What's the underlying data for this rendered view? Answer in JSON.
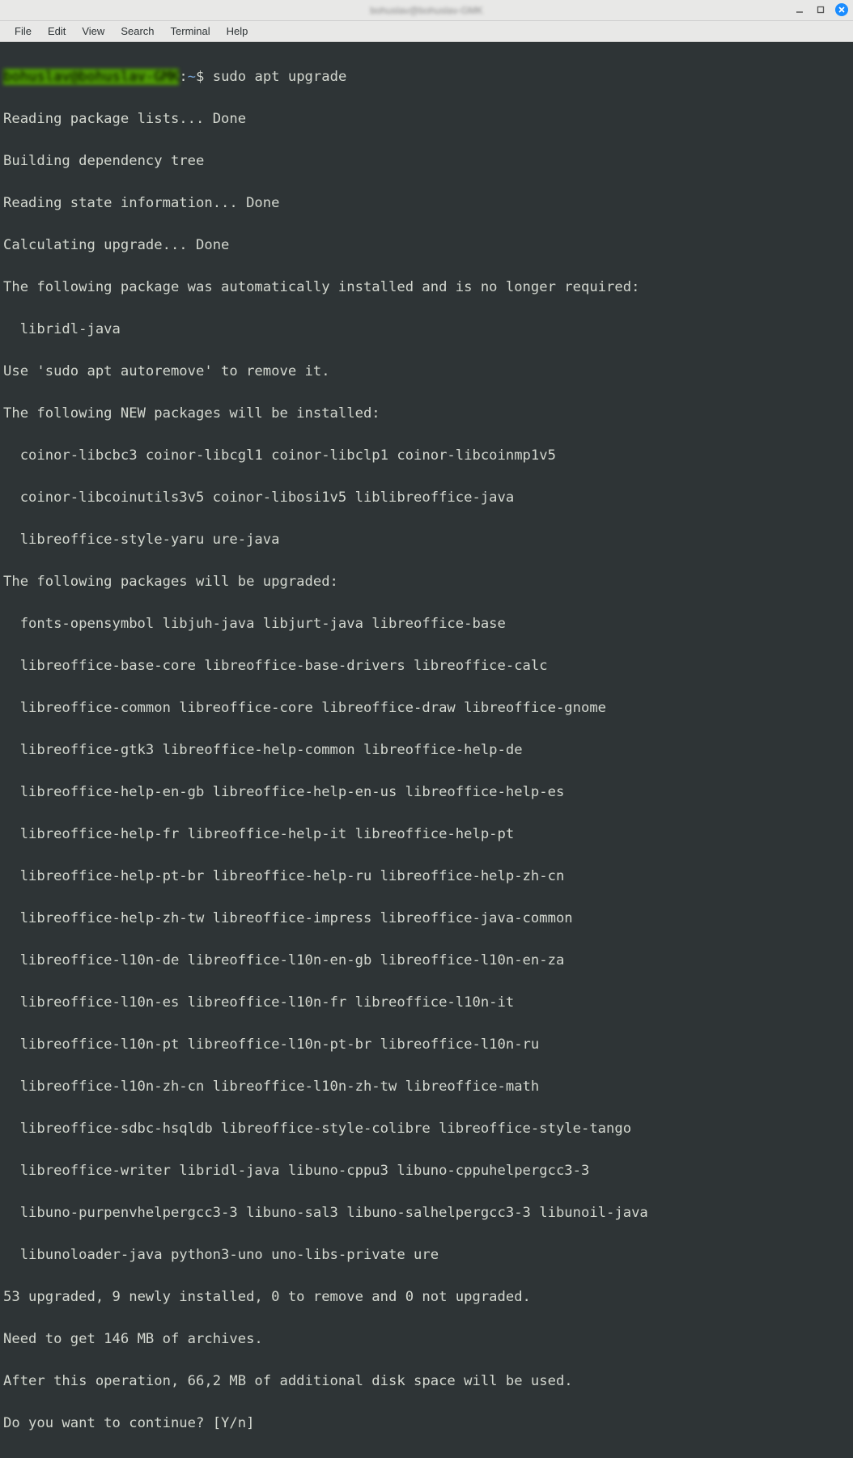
{
  "window": {
    "title": "bohuslav@bohuslav-GMK"
  },
  "menu": {
    "file": "File",
    "edit": "Edit",
    "view": "View",
    "search": "Search",
    "terminal": "Terminal",
    "help": "Help"
  },
  "prompt": {
    "user": "bohuslav@bohuslav-GMK",
    "sep1": ":",
    "path": "~",
    "sep2": "$ ",
    "command": "sudo apt upgrade"
  },
  "out": {
    "l1": "Reading package lists... Done",
    "l2": "Building dependency tree",
    "l3": "Reading state information... Done",
    "l4": "Calculating upgrade... Done",
    "l5": "The following package was automatically installed and is no longer required:",
    "l6": "libridl-java",
    "l7": "Use 'sudo apt autoremove' to remove it.",
    "l8": "The following NEW packages will be installed:",
    "l9": "coinor-libcbc3 coinor-libcgl1 coinor-libclp1 coinor-libcoinmp1v5",
    "l10": "coinor-libcoinutils3v5 coinor-libosi1v5 liblibreoffice-java",
    "l11": "libreoffice-style-yaru ure-java",
    "l12": "The following packages will be upgraded:",
    "l13": "fonts-opensymbol libjuh-java libjurt-java libreoffice-base",
    "l14": "libreoffice-base-core libreoffice-base-drivers libreoffice-calc",
    "l15": "libreoffice-common libreoffice-core libreoffice-draw libreoffice-gnome",
    "l16": "libreoffice-gtk3 libreoffice-help-common libreoffice-help-de",
    "l17": "libreoffice-help-en-gb libreoffice-help-en-us libreoffice-help-es",
    "l18": "libreoffice-help-fr libreoffice-help-it libreoffice-help-pt",
    "l19": "libreoffice-help-pt-br libreoffice-help-ru libreoffice-help-zh-cn",
    "l20": "libreoffice-help-zh-tw libreoffice-impress libreoffice-java-common",
    "l21": "libreoffice-l10n-de libreoffice-l10n-en-gb libreoffice-l10n-en-za",
    "l22": "libreoffice-l10n-es libreoffice-l10n-fr libreoffice-l10n-it",
    "l23": "libreoffice-l10n-pt libreoffice-l10n-pt-br libreoffice-l10n-ru",
    "l24": "libreoffice-l10n-zh-cn libreoffice-l10n-zh-tw libreoffice-math",
    "l25": "libreoffice-sdbc-hsqldb libreoffice-style-colibre libreoffice-style-tango",
    "l26": "libreoffice-writer libridl-java libuno-cppu3 libuno-cppuhelpergcc3-3",
    "l27": "libuno-purpenvhelpergcc3-3 libuno-sal3 libuno-salhelpergcc3-3 libunoil-java",
    "l28": "libunoloader-java python3-uno uno-libs-private ure",
    "l29": "53 upgraded, 9 newly installed, 0 to remove and 0 not upgraded.",
    "l30": "Need to get 146 MB of archives.",
    "l31": "After this operation, 66,2 MB of additional disk space will be used.",
    "l32": "Do you want to continue? [Y/n]"
  }
}
